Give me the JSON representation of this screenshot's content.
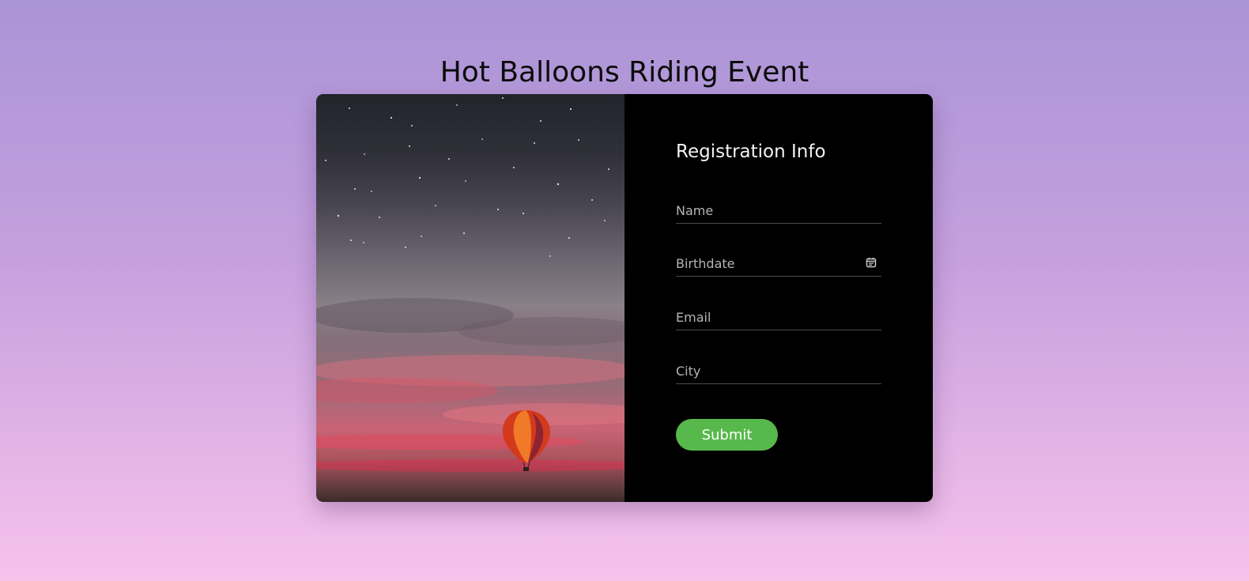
{
  "page": {
    "title": "Hot Balloons Riding Event"
  },
  "hero_image": {
    "description_icon": "hot-air-balloon-sunset-photo"
  },
  "form": {
    "title": "Registration Info",
    "fields": {
      "name": {
        "placeholder": "Name",
        "value": ""
      },
      "birthdate": {
        "placeholder": "Birthdate",
        "value": "",
        "icon": "calendar-icon"
      },
      "email": {
        "placeholder": "Email",
        "value": ""
      },
      "city": {
        "placeholder": "City",
        "value": ""
      }
    },
    "submit_label": "Submit"
  },
  "colors": {
    "background_top": "#a994d6",
    "background_bottom": "#f7c2ec",
    "form_background": "#000000",
    "submit_button": "#57b94b",
    "title_text": "#0b0b0b"
  }
}
